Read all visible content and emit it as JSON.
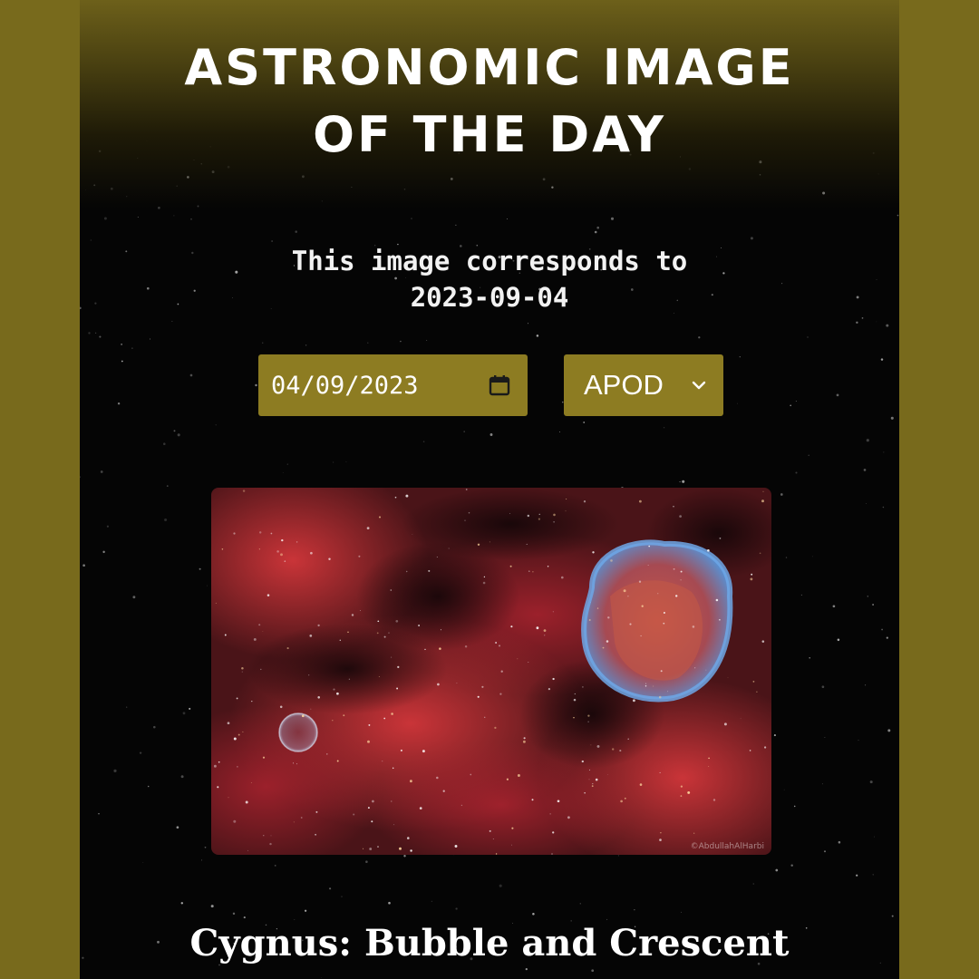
{
  "header": {
    "title_line1": "ASTRONOMIC IMAGE",
    "title_line2": "OF THE DAY"
  },
  "subtitle": {
    "line1": "This image corresponds to",
    "line2": "2023-09-04"
  },
  "controls": {
    "date_value": "04/09/2023",
    "source_selected": "APOD",
    "calendar_icon": "calendar-icon",
    "dropdown_icon": "chevron-down-icon"
  },
  "image": {
    "credit": "©AbdullahAlHarbi"
  },
  "caption": {
    "title": "Cygnus: Bubble and Crescent"
  },
  "colors": {
    "frame": "#786a1c",
    "accent": "#8d7c22",
    "background": "#050505",
    "text": "#ffffff"
  }
}
